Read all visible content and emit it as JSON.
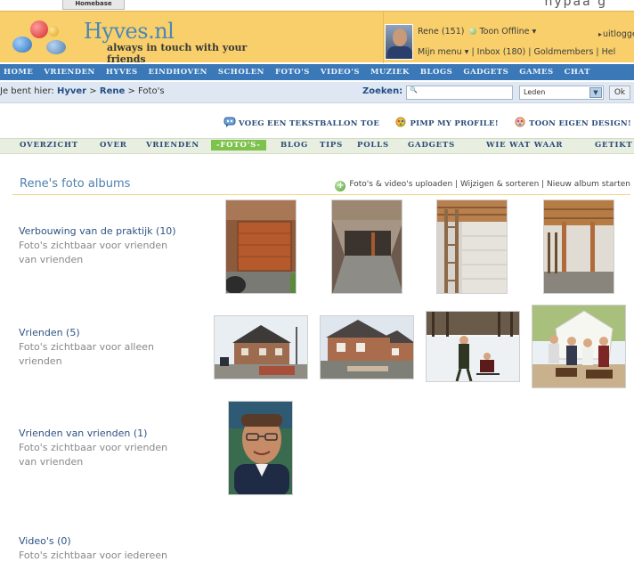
{
  "top": {
    "button_label": "Homebase",
    "tail_text": "nypãà g"
  },
  "logo": {
    "name": "Hyves.nl",
    "tagline": "always in touch with your friends"
  },
  "user": {
    "name_count": "Rene (151)",
    "status": "Toon Offline ▾",
    "logout": "uitloggen",
    "menu_line": "Mijn menu ▾ | Inbox (180) | Goldmembers | Hel"
  },
  "main_nav": [
    "HOME",
    "VRIENDEN",
    "HYVES",
    "EINDHOVEN",
    "SCHOLEN",
    "FOTO'S",
    "VIDEO'S",
    "MUZIEK",
    "BLOGS",
    "GADGETS",
    "GAMES",
    "CHAT"
  ],
  "breadcrumb": {
    "prefix": "Je bent hier:",
    "items": [
      "Hyver",
      "Rene",
      "Foto's"
    ],
    "sep": ">"
  },
  "search": {
    "label": "Zoeken:",
    "select_value": "Leden",
    "ok": "Ok"
  },
  "actions": [
    "VOEG EEN TEKSTBALLON TOE",
    "PIMP MY PROFILE!",
    "TOON EIGEN DESIGN!"
  ],
  "sub_nav": [
    "OVERZICHT",
    "OVER",
    "VRIENDEN",
    "-FOTO'S-",
    "BLOG",
    "TIPS",
    "POLLS",
    "GADGETS",
    "WIE WAT WAAR",
    "GETIKT"
  ],
  "section": {
    "title": "Rene's foto albums",
    "links": "Foto's & video's uploaden | Wijzigen & sorteren | Nieuw album starten"
  },
  "albums": [
    {
      "name": "Verbouwing van de praktijk (10)",
      "vis1": "Foto's zichtbaar voor vrienden",
      "vis2": "van vrienden"
    },
    {
      "name": "Vrienden (5)",
      "vis1": "Foto's zichtbaar voor alleen",
      "vis2": "vrienden"
    },
    {
      "name": "Vrienden van vrienden (1)",
      "vis1": "Foto's zichtbaar voor vrienden",
      "vis2": "van vrienden"
    },
    {
      "name": "Video's (0)",
      "vis1": "Foto's zichtbaar voor iedereen",
      "vis2": ""
    }
  ]
}
